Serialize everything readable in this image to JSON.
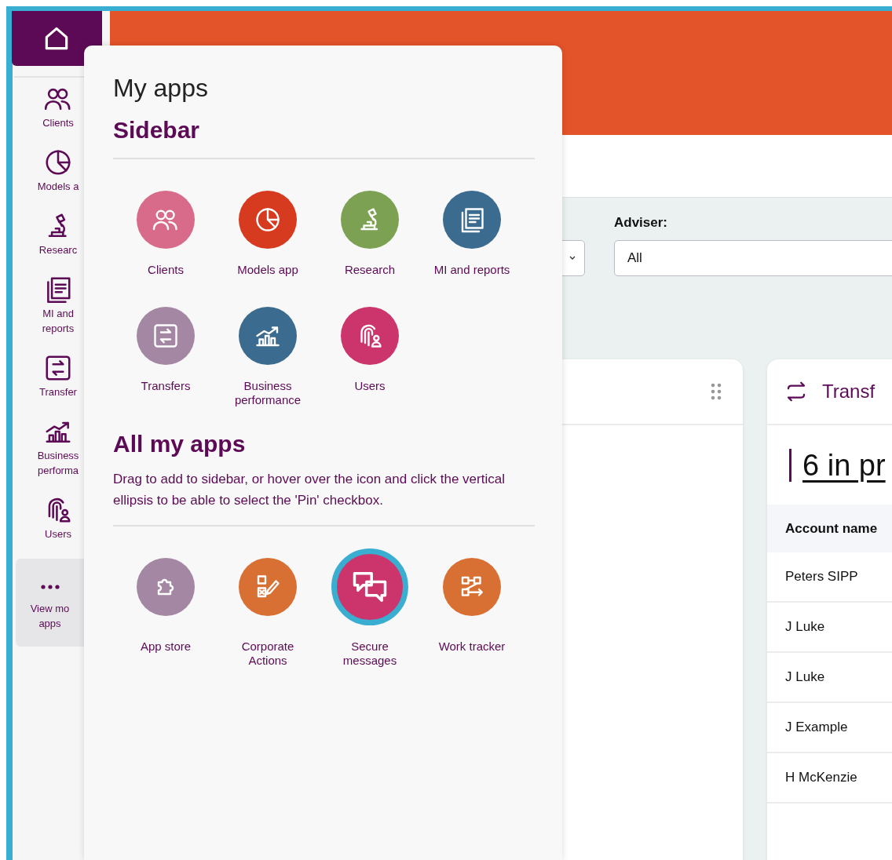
{
  "rail": {
    "items": [
      {
        "kind": "clients",
        "lines": [
          "Clients"
        ]
      },
      {
        "kind": "models",
        "lines": [
          "Models a"
        ]
      },
      {
        "kind": "research",
        "lines": [
          "Researc"
        ]
      },
      {
        "kind": "reports",
        "lines": [
          "MI and",
          "reports"
        ]
      },
      {
        "kind": "transfers",
        "lines": [
          "Transfer"
        ]
      },
      {
        "kind": "business",
        "lines": [
          "Business",
          "performa"
        ]
      },
      {
        "kind": "users",
        "lines": [
          "Users"
        ]
      }
    ],
    "more": {
      "lines": [
        "View mo",
        "apps"
      ]
    }
  },
  "filters": {
    "adviser": {
      "label": "Adviser:",
      "value": "All"
    }
  },
  "transfers_card": {
    "title": "Transf",
    "summary": "6 in pr",
    "table": {
      "columns": [
        "Account name"
      ],
      "rows": [
        "Peters SIPP",
        "J Luke",
        "J Luke",
        "J Example",
        "H McKenzie"
      ]
    }
  },
  "panel": {
    "title": "My apps",
    "sidebar_heading": "Sidebar",
    "sidebar_apps": [
      {
        "kind": "clients",
        "label": "Clients",
        "color": "#d96b8a"
      },
      {
        "kind": "models",
        "label": "Models app",
        "color": "#d63a1f"
      },
      {
        "kind": "research",
        "label": "Research",
        "color": "#7da152"
      },
      {
        "kind": "reports",
        "label": "MI and reports",
        "color": "#3b6b8e"
      },
      {
        "kind": "transfers",
        "label": "Transfers",
        "color": "#a387a3"
      },
      {
        "kind": "business",
        "label": "Business performance",
        "color": "#3b6b8e"
      },
      {
        "kind": "users",
        "label": "Users",
        "color": "#cc356b"
      }
    ],
    "all_heading": "All my apps",
    "hint": "Drag to add to sidebar, or hover over the icon and click the vertical ellipsis to be able to select the 'Pin' checkbox.",
    "all_apps": [
      {
        "kind": "puzzle",
        "label": "App store",
        "color": "#a387a3",
        "selected": false
      },
      {
        "kind": "corporate",
        "label": "Corporate Actions",
        "color": "#d87033",
        "selected": false
      },
      {
        "kind": "messages",
        "label": "Secure messages",
        "color": "#cc356b",
        "selected": true
      },
      {
        "kind": "workflow",
        "label": "Work tracker",
        "color": "#d87033",
        "selected": false
      }
    ]
  }
}
